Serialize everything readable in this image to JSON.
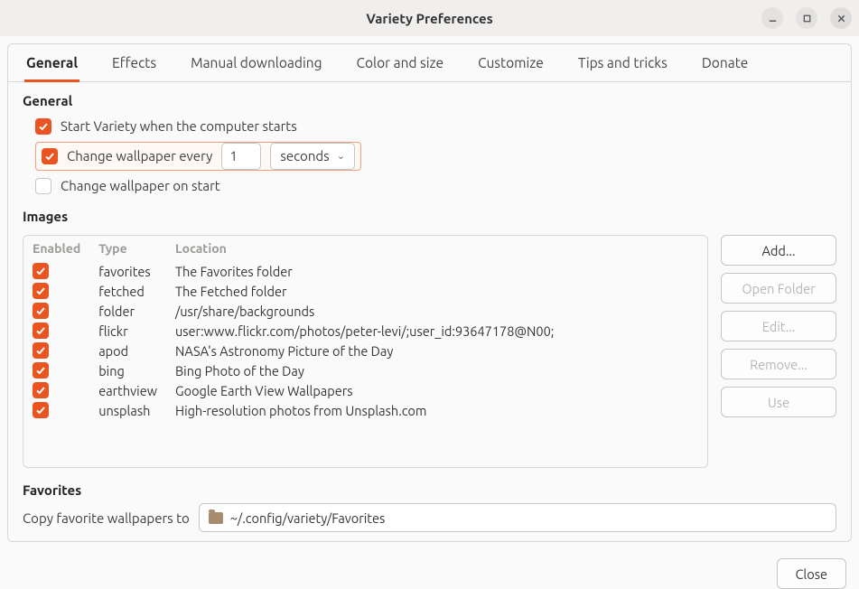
{
  "window": {
    "title": "Variety Preferences"
  },
  "tabs": [
    "General",
    "Effects",
    "Manual downloading",
    "Color and size",
    "Customize",
    "Tips and tricks",
    "Donate"
  ],
  "active_tab": 0,
  "general": {
    "heading": "General",
    "option_start": "Start Variety when the computer starts",
    "option_start_checked": true,
    "option_change": "Change wallpaper every",
    "option_change_checked": true,
    "change_value": "1",
    "change_unit": "seconds",
    "option_onstart": "Change wallpaper on start",
    "option_onstart_checked": false
  },
  "images": {
    "heading": "Images",
    "columns": [
      "Enabled",
      "Type",
      "Location"
    ],
    "rows": [
      {
        "enabled": true,
        "type": "favorites",
        "location": "The Favorites folder"
      },
      {
        "enabled": true,
        "type": "fetched",
        "location": "The Fetched folder"
      },
      {
        "enabled": true,
        "type": "folder",
        "location": "/usr/share/backgrounds"
      },
      {
        "enabled": true,
        "type": "flickr",
        "location": "user:www.flickr.com/photos/peter-levi/;user_id:93647178@N00;"
      },
      {
        "enabled": true,
        "type": "apod",
        "location": "NASA's Astronomy Picture of the Day"
      },
      {
        "enabled": true,
        "type": "bing",
        "location": "Bing Photo of the Day"
      },
      {
        "enabled": true,
        "type": "earthview",
        "location": "Google Earth View Wallpapers"
      },
      {
        "enabled": true,
        "type": "unsplash",
        "location": "High-resolution photos from Unsplash.com"
      }
    ],
    "buttons": {
      "add": "Add...",
      "open": "Open Folder",
      "edit": "Edit...",
      "remove": "Remove...",
      "use": "Use"
    }
  },
  "favorites": {
    "heading": "Favorites",
    "label": "Copy favorite wallpapers to",
    "path": "~/.config/variety/Favorites"
  },
  "footer": {
    "close": "Close"
  }
}
